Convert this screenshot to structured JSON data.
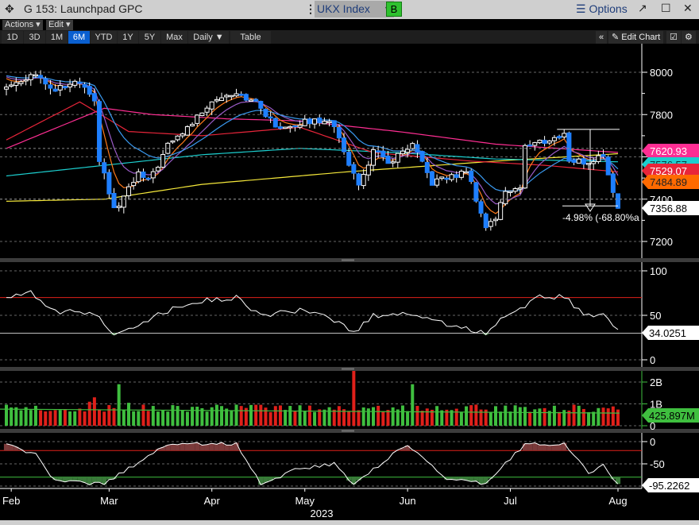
{
  "window": {
    "title": "G 153: Launchpad GPC",
    "ticker": "UKX Index",
    "b_button": "B",
    "options": "Options",
    "move_icon": "✥",
    "popout": "↗",
    "maximize": "☐",
    "close": "✕"
  },
  "toolbar": {
    "actions": "Actions ▾",
    "edit": "Edit ▾",
    "periods": [
      "1D",
      "3D",
      "1M",
      "6M",
      "YTD",
      "1Y",
      "5Y",
      "Max"
    ],
    "active_period": "6M",
    "frequency": "Daily ▼",
    "table": "Table",
    "collapse": "«",
    "edit_chart": "Edit Chart"
  },
  "colors": {
    "up": "#ffffff",
    "down": "#1e7fff",
    "ma_yellow": "#f5e83a",
    "ma_cyan": "#1ccfcf",
    "ma_crimson": "#e8253a",
    "ma_pink": "#ff2e93",
    "ma_orange": "#ff7a1a",
    "ma_purple": "#9b5cc8",
    "ma_blue": "#3a9af0",
    "vol_up": "#3fbf3f",
    "vol_down": "#e0201a"
  },
  "chart_data": {
    "type": "candlestick",
    "xlabel": "2023",
    "x_ticks": [
      {
        "label": "Feb",
        "day": 1
      },
      {
        "label": "Mar",
        "day": 21
      },
      {
        "label": "Apr",
        "day": 42
      },
      {
        "label": "May",
        "day": 61
      },
      {
        "label": "Jun",
        "day": 82
      },
      {
        "label": "Jul",
        "day": 103
      },
      {
        "label": "Aug",
        "day": 125
      }
    ],
    "n_days": 126,
    "price": {
      "y_ticks": [
        8000,
        7800,
        7600,
        7400,
        7200
      ],
      "ylim": [
        7120,
        8110
      ],
      "close_keypoints": [
        [
          0,
          7930
        ],
        [
          6,
          8000
        ],
        [
          9,
          7910
        ],
        [
          15,
          7950
        ],
        [
          18,
          7850
        ],
        [
          19,
          7590
        ],
        [
          22,
          7350
        ],
        [
          23,
          7370
        ],
        [
          27,
          7520
        ],
        [
          29,
          7480
        ],
        [
          33,
          7650
        ],
        [
          38,
          7760
        ],
        [
          42,
          7870
        ],
        [
          47,
          7910
        ],
        [
          52,
          7835
        ],
        [
          55,
          7740
        ],
        [
          60,
          7760
        ],
        [
          66,
          7780
        ],
        [
          69,
          7630
        ],
        [
          72,
          7460
        ],
        [
          75,
          7630
        ],
        [
          78,
          7570
        ],
        [
          83,
          7650
        ],
        [
          87,
          7480
        ],
        [
          93,
          7520
        ],
        [
          94,
          7540
        ],
        [
          98,
          7270
        ],
        [
          100,
          7310
        ],
        [
          102,
          7440
        ],
        [
          105,
          7460
        ],
        [
          106,
          7650
        ],
        [
          114,
          7700
        ],
        [
          115,
          7590
        ],
        [
          119,
          7570
        ],
        [
          122,
          7610
        ],
        [
          123,
          7520
        ],
        [
          125,
          7356.88
        ]
      ],
      "moving_averages": [
        {
          "name": "ma-yellow",
          "color_key": "ma_yellow",
          "points": [
            [
              0,
              7390
            ],
            [
              20,
              7400
            ],
            [
              40,
              7470
            ],
            [
              70,
              7530
            ],
            [
              100,
              7580
            ],
            [
              125,
              7615
            ]
          ]
        },
        {
          "name": "ma-cyan",
          "color_key": "ma_cyan",
          "points": [
            [
              0,
              7510
            ],
            [
              20,
              7560
            ],
            [
              40,
              7610
            ],
            [
              60,
              7640
            ],
            [
              80,
              7620
            ],
            [
              100,
              7590
            ],
            [
              125,
              7576.57
            ]
          ]
        },
        {
          "name": "ma-pink",
          "color_key": "ma_pink",
          "points": [
            [
              0,
              7640
            ],
            [
              20,
              7830
            ],
            [
              30,
              7800
            ],
            [
              45,
              7780
            ],
            [
              60,
              7770
            ],
            [
              80,
              7720
            ],
            [
              100,
              7660
            ],
            [
              125,
              7620.93
            ]
          ]
        },
        {
          "name": "ma-crimson",
          "color_key": "ma_crimson",
          "points": [
            [
              0,
              7680
            ],
            [
              15,
              7860
            ],
            [
              25,
              7720
            ],
            [
              40,
              7700
            ],
            [
              60,
              7740
            ],
            [
              75,
              7620
            ],
            [
              95,
              7580
            ],
            [
              110,
              7560
            ],
            [
              125,
              7529.07
            ]
          ]
        }
      ],
      "ema_periods": [
        {
          "name": "ma-orange",
          "color_key": "ma_orange",
          "period": 5
        },
        {
          "name": "ma-purple",
          "color_key": "ma_purple",
          "period": 9
        },
        {
          "name": "ma-blue",
          "color_key": "ma_blue",
          "period": 18
        }
      ],
      "labels": [
        {
          "text": "7620.93",
          "value": 7620.93,
          "color": "#ff2e93",
          "fg": "#fff"
        },
        {
          "text": "7576.57",
          "value": 7576.57,
          "color": "#1ccfcf",
          "fg": "#0a3a3a"
        },
        {
          "text": "7529.07",
          "value": 7529.07,
          "color": "#e8253a",
          "fg": "#fff"
        },
        {
          "text": "7484.89",
          "value": 7484.89,
          "color": "#ff6a00",
          "fg": "#222"
        },
        {
          "text": "7356.88",
          "value": 7356.88,
          "color": "#ffffff",
          "fg": "#000"
        }
      ],
      "annotation": {
        "text": "-4.98% (-68.80%a",
        "from_day": 114,
        "to_day": 125,
        "high": 7730,
        "low": 7357
      }
    },
    "rsi": {
      "y_ticks": [
        100,
        50,
        0
      ],
      "upper": 70,
      "lower": 30,
      "last_label": "34.0251",
      "points": [
        [
          0,
          70
        ],
        [
          5,
          75
        ],
        [
          9,
          55
        ],
        [
          18,
          52
        ],
        [
          22,
          30
        ],
        [
          26,
          38
        ],
        [
          33,
          55
        ],
        [
          38,
          65
        ],
        [
          47,
          70
        ],
        [
          52,
          50
        ],
        [
          60,
          55
        ],
        [
          67,
          45
        ],
        [
          71,
          30
        ],
        [
          75,
          50
        ],
        [
          83,
          52
        ],
        [
          90,
          40
        ],
        [
          98,
          30
        ],
        [
          102,
          50
        ],
        [
          109,
          70
        ],
        [
          114,
          72
        ],
        [
          118,
          50
        ],
        [
          122,
          52
        ],
        [
          125,
          34.03
        ]
      ]
    },
    "volume": {
      "y_ticks": [
        "2B",
        "1B",
        "0"
      ],
      "tick_values": [
        2,
        1,
        0
      ],
      "average": 0.76,
      "last_label": "425.897M",
      "base": 0.62,
      "spikes": [
        [
          17,
          1.1
        ],
        [
          18,
          1.3
        ],
        [
          23,
          1.9
        ],
        [
          71,
          2.6
        ],
        [
          83,
          1.9
        ],
        [
          25,
          1.05
        ],
        [
          105,
          0.85
        ]
      ]
    },
    "oscillator": {
      "y_ticks": [
        0,
        -50
      ],
      "upper": -20,
      "lower": -80,
      "last_label": "-95.2262",
      "points": [
        [
          0,
          -5
        ],
        [
          6,
          -30
        ],
        [
          10,
          -90
        ],
        [
          20,
          -95
        ],
        [
          25,
          -60
        ],
        [
          33,
          -5
        ],
        [
          47,
          -5
        ],
        [
          52,
          -95
        ],
        [
          60,
          -60
        ],
        [
          67,
          -50
        ],
        [
          71,
          -95
        ],
        [
          82,
          -5
        ],
        [
          90,
          -85
        ],
        [
          98,
          -95
        ],
        [
          106,
          -5
        ],
        [
          114,
          -5
        ],
        [
          119,
          -70
        ],
        [
          122,
          -55
        ],
        [
          125,
          -95.23
        ]
      ]
    }
  }
}
